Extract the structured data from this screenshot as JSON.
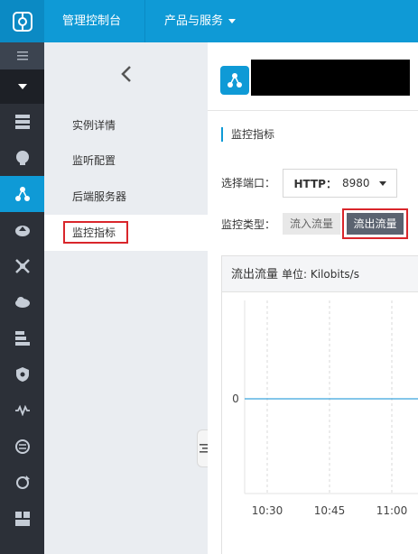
{
  "topbar": {
    "logo_icon": "aliyun-logo-icon",
    "console_label": "管理控制台",
    "products_label": "产品与服务"
  },
  "iconbar": {
    "icons": [
      "menu-icon",
      "toggle-down-icon",
      "server-icon",
      "cloud-db-icon",
      "load-balancer-icon",
      "cloud-upload-icon",
      "network-icon",
      "cloud-storage-icon",
      "database-icon",
      "shield-icon",
      "waveform-icon",
      "exchange-icon",
      "refresh-icon",
      "dashboard-icon"
    ],
    "active": "load-balancer-icon"
  },
  "subnav": {
    "back_icon": "chevron-left-icon",
    "items": [
      {
        "label": "实例详情"
      },
      {
        "label": "监听配置"
      },
      {
        "label": "后端服务器"
      },
      {
        "label": "监控指标"
      }
    ],
    "active_index": 3
  },
  "main": {
    "section_title": "监控指标",
    "port_label": "选择端口：",
    "port_protocol": "HTTP：",
    "port_value": "8980",
    "type_label": "监控类型：",
    "tabs": [
      {
        "label": "流入流量"
      },
      {
        "label": "流出流量"
      }
    ],
    "active_tab": 1,
    "chart_title": "流出流量",
    "chart_unit": "单位: Kilobits/s"
  },
  "colors": {
    "brand": "#0f9ad6",
    "highlight": "#d9262b",
    "sidebar": "#2c3038"
  },
  "chart_data": {
    "type": "line",
    "title": "流出流量",
    "ylabel": "单位: Kilobits/s",
    "y_ticks": [
      "0"
    ],
    "x_ticks": [
      "10:30",
      "10:45",
      "11:00"
    ],
    "series": [
      {
        "x": [
          "10:30",
          "10:45",
          "11:00"
        ],
        "values": [
          0,
          0,
          0
        ]
      }
    ],
    "grid": "vertical dashed"
  }
}
